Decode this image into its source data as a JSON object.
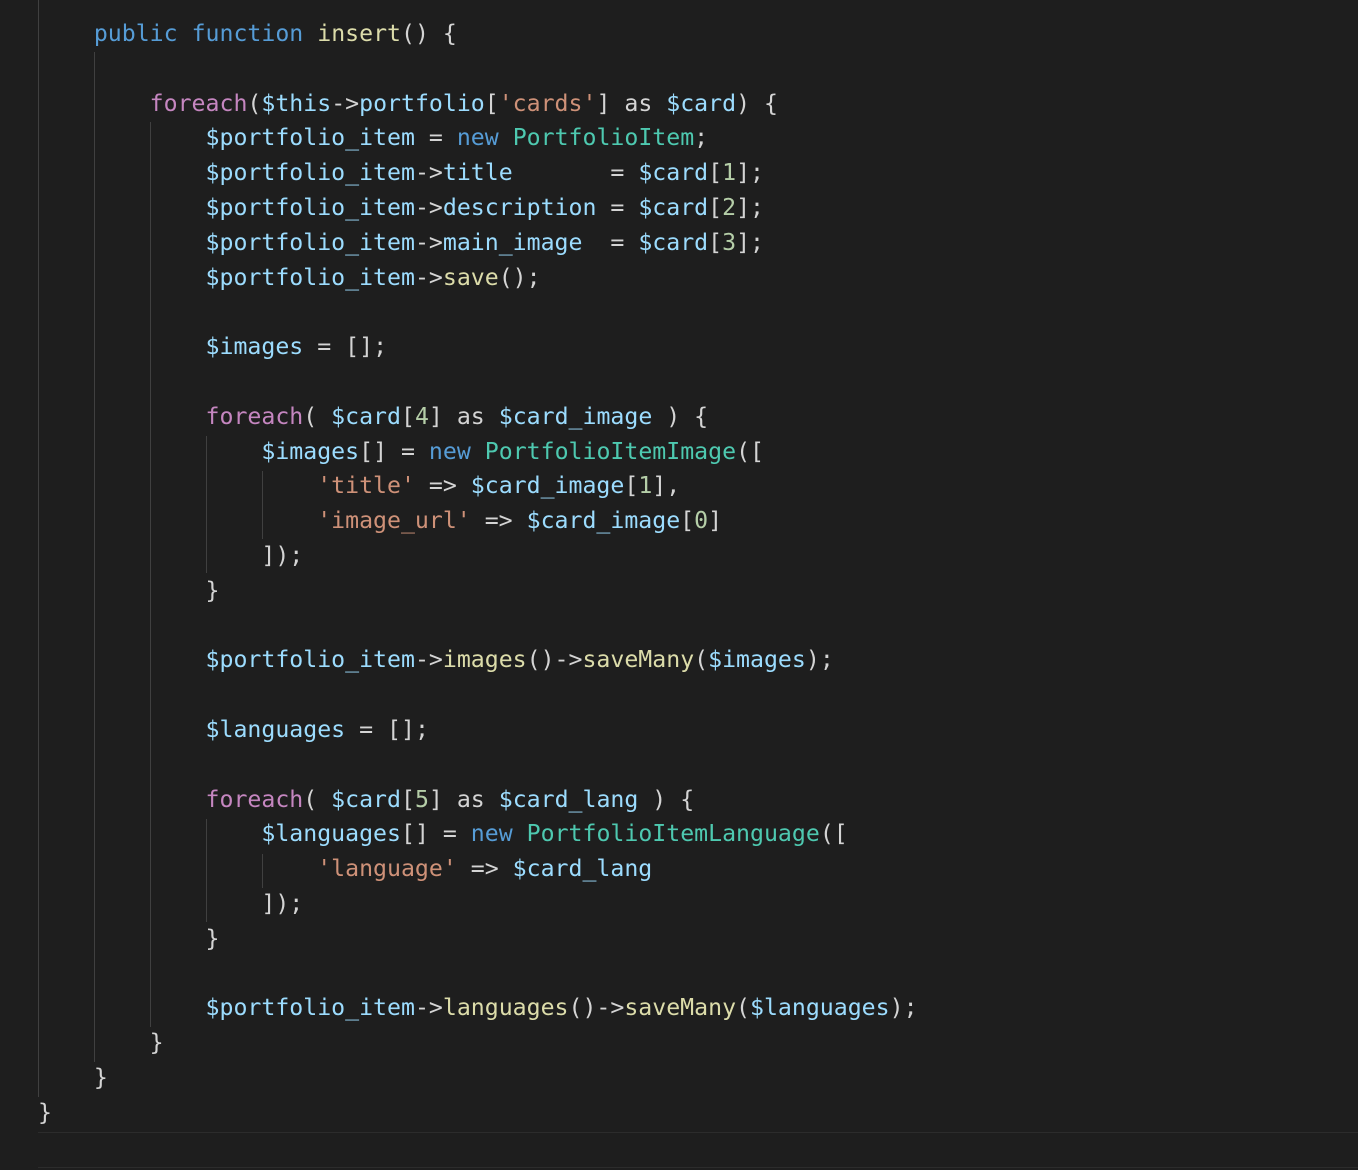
{
  "editor": {
    "theme": "dark",
    "colors": {
      "background": "#1e1e1e",
      "keyword": "#569cd6",
      "control": "#c586c0",
      "function": "#dcdcaa",
      "variable": "#9cdcfe",
      "class": "#4ec9b0",
      "string": "#ce9178",
      "number": "#b5cea8",
      "plain": "#d4d4d4"
    }
  },
  "code": {
    "lines": [
      [
        [
          "kw",
          "    public"
        ],
        [
          "pl",
          " "
        ],
        [
          "kw",
          "function"
        ],
        [
          "pl",
          " "
        ],
        [
          "fn",
          "insert"
        ],
        [
          "pl",
          "() {"
        ]
      ],
      [],
      [
        [
          "ctl",
          "        foreach"
        ],
        [
          "pl",
          "("
        ],
        [
          "var",
          "$this"
        ],
        [
          "pl",
          "->"
        ],
        [
          "var",
          "portfolio"
        ],
        [
          "pl",
          "["
        ],
        [
          "str",
          "'cards'"
        ],
        [
          "pl",
          "] as "
        ],
        [
          "var",
          "$card"
        ],
        [
          "pl",
          ") {"
        ]
      ],
      [
        [
          "pl",
          "            "
        ],
        [
          "var",
          "$portfolio_item"
        ],
        [
          "pl",
          " = "
        ],
        [
          "kw",
          "new"
        ],
        [
          "pl",
          " "
        ],
        [
          "cls",
          "PortfolioItem"
        ],
        [
          "pl",
          ";"
        ]
      ],
      [
        [
          "pl",
          "            "
        ],
        [
          "var",
          "$portfolio_item"
        ],
        [
          "pl",
          "->"
        ],
        [
          "var",
          "title"
        ],
        [
          "pl",
          "       = "
        ],
        [
          "var",
          "$card"
        ],
        [
          "pl",
          "["
        ],
        [
          "num",
          "1"
        ],
        [
          "pl",
          "];"
        ]
      ],
      [
        [
          "pl",
          "            "
        ],
        [
          "var",
          "$portfolio_item"
        ],
        [
          "pl",
          "->"
        ],
        [
          "var",
          "description"
        ],
        [
          "pl",
          " = "
        ],
        [
          "var",
          "$card"
        ],
        [
          "pl",
          "["
        ],
        [
          "num",
          "2"
        ],
        [
          "pl",
          "];"
        ]
      ],
      [
        [
          "pl",
          "            "
        ],
        [
          "var",
          "$portfolio_item"
        ],
        [
          "pl",
          "->"
        ],
        [
          "var",
          "main_image"
        ],
        [
          "pl",
          "  = "
        ],
        [
          "var",
          "$card"
        ],
        [
          "pl",
          "["
        ],
        [
          "num",
          "3"
        ],
        [
          "pl",
          "];"
        ]
      ],
      [
        [
          "pl",
          "            "
        ],
        [
          "var",
          "$portfolio_item"
        ],
        [
          "pl",
          "->"
        ],
        [
          "fn",
          "save"
        ],
        [
          "pl",
          "();"
        ]
      ],
      [],
      [
        [
          "pl",
          "            "
        ],
        [
          "var",
          "$images"
        ],
        [
          "pl",
          " = [];"
        ]
      ],
      [],
      [
        [
          "ctl",
          "            foreach"
        ],
        [
          "pl",
          "( "
        ],
        [
          "var",
          "$card"
        ],
        [
          "pl",
          "["
        ],
        [
          "num",
          "4"
        ],
        [
          "pl",
          "] as "
        ],
        [
          "var",
          "$card_image"
        ],
        [
          "pl",
          " ) {"
        ]
      ],
      [
        [
          "pl",
          "                "
        ],
        [
          "var",
          "$images"
        ],
        [
          "pl",
          "[] = "
        ],
        [
          "kw",
          "new"
        ],
        [
          "pl",
          " "
        ],
        [
          "cls",
          "PortfolioItemImage"
        ],
        [
          "pl",
          "(["
        ]
      ],
      [
        [
          "pl",
          "                    "
        ],
        [
          "str",
          "'title'"
        ],
        [
          "pl",
          " => "
        ],
        [
          "var",
          "$card_image"
        ],
        [
          "pl",
          "["
        ],
        [
          "num",
          "1"
        ],
        [
          "pl",
          "],"
        ]
      ],
      [
        [
          "pl",
          "                    "
        ],
        [
          "str",
          "'image_url'"
        ],
        [
          "pl",
          " => "
        ],
        [
          "var",
          "$card_image"
        ],
        [
          "pl",
          "["
        ],
        [
          "num",
          "0"
        ],
        [
          "pl",
          "]"
        ]
      ],
      [
        [
          "pl",
          "                ]);"
        ]
      ],
      [
        [
          "pl",
          "            }"
        ]
      ],
      [],
      [
        [
          "pl",
          "            "
        ],
        [
          "var",
          "$portfolio_item"
        ],
        [
          "pl",
          "->"
        ],
        [
          "fn",
          "images"
        ],
        [
          "pl",
          "()->"
        ],
        [
          "fn",
          "saveMany"
        ],
        [
          "pl",
          "("
        ],
        [
          "var",
          "$images"
        ],
        [
          "pl",
          ");"
        ]
      ],
      [],
      [
        [
          "pl",
          "            "
        ],
        [
          "var",
          "$languages"
        ],
        [
          "pl",
          " = [];"
        ]
      ],
      [],
      [
        [
          "ctl",
          "            foreach"
        ],
        [
          "pl",
          "( "
        ],
        [
          "var",
          "$card"
        ],
        [
          "pl",
          "["
        ],
        [
          "num",
          "5"
        ],
        [
          "pl",
          "] as "
        ],
        [
          "var",
          "$card_lang"
        ],
        [
          "pl",
          " ) {"
        ]
      ],
      [
        [
          "pl",
          "                "
        ],
        [
          "var",
          "$languages"
        ],
        [
          "pl",
          "[] = "
        ],
        [
          "kw",
          "new"
        ],
        [
          "pl",
          " "
        ],
        [
          "cls",
          "PortfolioItemLanguage"
        ],
        [
          "pl",
          "(["
        ]
      ],
      [
        [
          "pl",
          "                    "
        ],
        [
          "str",
          "'language'"
        ],
        [
          "pl",
          " => "
        ],
        [
          "var",
          "$card_lang"
        ]
      ],
      [
        [
          "pl",
          "                ]);"
        ]
      ],
      [
        [
          "pl",
          "            }"
        ]
      ],
      [],
      [
        [
          "pl",
          "            "
        ],
        [
          "var",
          "$portfolio_item"
        ],
        [
          "pl",
          "->"
        ],
        [
          "fn",
          "languages"
        ],
        [
          "pl",
          "()->"
        ],
        [
          "fn",
          "saveMany"
        ],
        [
          "pl",
          "("
        ],
        [
          "var",
          "$languages"
        ],
        [
          "pl",
          ");"
        ]
      ],
      [
        [
          "pl",
          "        }"
        ]
      ],
      [
        [
          "pl",
          "    }"
        ]
      ],
      [
        [
          "pl",
          "}"
        ]
      ],
      []
    ]
  }
}
